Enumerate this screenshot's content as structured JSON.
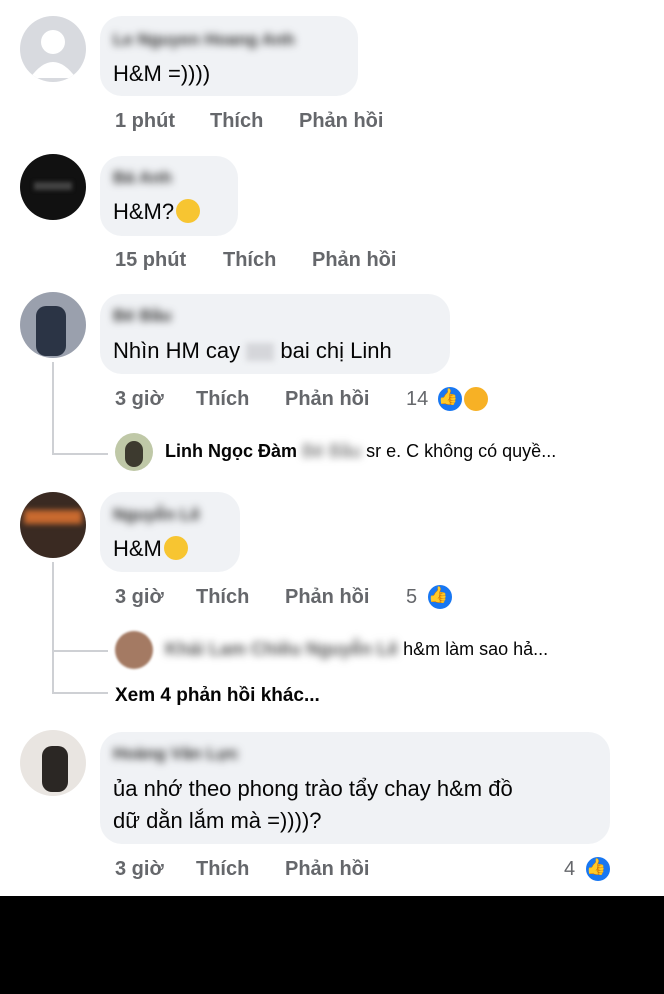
{
  "comments": [
    {
      "author": "Le Nguyen Hoang Anh",
      "text": "H&M =))))",
      "time": "1 phút",
      "like_label": "Thích",
      "reply_label": "Phản hồi"
    },
    {
      "author": "Bá Anh",
      "text": "H&M?",
      "emoji": "thinking-face",
      "time": "15 phút",
      "like_label": "Thích",
      "reply_label": "Phản hồi"
    },
    {
      "author": "Bé Bầu",
      "text_before": "Nhìn HM cay",
      "text_after": "bai chị Linh",
      "time": "3 giờ",
      "like_label": "Thích",
      "reply_label": "Phản hồi",
      "reaction_count": "14",
      "reactions": [
        "like",
        "laugh"
      ],
      "reply": {
        "author": "Linh Ngọc Đàm",
        "tag": "Bé Bầu",
        "text": "sr e. C không có quyề..."
      }
    },
    {
      "author": "Nguyễn Lê",
      "text": "H&M",
      "emoji": "worried-face",
      "time": "3 giờ",
      "like_label": "Thích",
      "reply_label": "Phản hồi",
      "reaction_count": "5",
      "reactions": [
        "like"
      ],
      "reply": {
        "author": "Khải Lam Chiêu Nguyễn Lê",
        "text": "h&m làm sao hả..."
      },
      "more_replies": "Xem 4 phản hồi khác..."
    },
    {
      "author": "Hoàng Văn Lực",
      "text_line1": "ủa nhớ theo phong trào tẩy chay h&m đồ",
      "text_line2": "dữ dằn lắm mà =))))?",
      "time": "3 giờ",
      "like_label": "Thích",
      "reply_label": "Phản hồi",
      "reaction_count": "4",
      "reactions": [
        "like"
      ]
    }
  ],
  "colors": {
    "bubble": "#f0f2f5",
    "meta": "#65676b",
    "like_blue": "#1877f2"
  }
}
